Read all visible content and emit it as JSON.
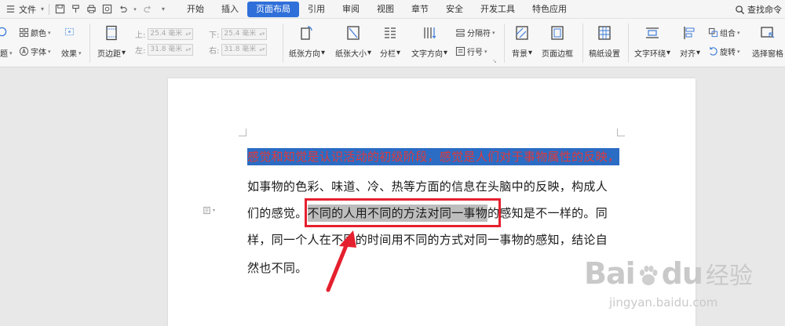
{
  "menubar": {
    "file_label": "文件",
    "tabs": [
      {
        "label": "开始",
        "active": false
      },
      {
        "label": "插入",
        "active": false
      },
      {
        "label": "页面布局",
        "active": true
      },
      {
        "label": "引用",
        "active": false
      },
      {
        "label": "审阅",
        "active": false
      },
      {
        "label": "视图",
        "active": false
      },
      {
        "label": "章节",
        "active": false
      },
      {
        "label": "安全",
        "active": false
      },
      {
        "label": "开发工具",
        "active": false
      },
      {
        "label": "特色应用",
        "active": false
      }
    ],
    "find_label": "查找命令"
  },
  "ribbon": {
    "theme_partial": "题",
    "color_label": "颜色",
    "font_label": "字体",
    "effect_label": "效果",
    "margins_label": "页边距",
    "margin_top_label": "上:",
    "margin_top_value": "25.4 毫米",
    "margin_bottom_label": "下:",
    "margin_bottom_value": "25.4 毫米",
    "margin_left_label": "左:",
    "margin_left_value": "31.8 毫米",
    "margin_right_label": "右:",
    "margin_right_value": "31.8 毫米",
    "orientation_label": "纸张方向",
    "size_label": "纸张大小",
    "columns_label": "分栏",
    "text_direction_label": "文字方向",
    "breaks_label": "分隔符",
    "line_numbers_label": "行号",
    "background_label": "背景",
    "page_border_label": "页面边框",
    "draft_paper_label": "稿纸设置",
    "text_wrap_label": "文字环绕",
    "align_label": "对齐",
    "group_label": "组合",
    "rotate_label": "旋转",
    "selection_pane_label": "选择窗格"
  },
  "document": {
    "line1_highlighted": "感觉和知觉是认识活动的初级阶段，感觉是人们对于事物属性的反映，",
    "line2": "如事物的色彩、味道、冷、热等方面的信息在头脑中的反映，构成人",
    "line3_before": "们的感觉。",
    "line3_selected": "不同的人用不同的方法对同一事物",
    "line3_after": "的感知是不一样的。同",
    "line4": "样，同一个人在不同的时间用不同的方式对同一事物的感知，结论自",
    "line5": "然也不同。"
  },
  "watermark": {
    "brand_bai": "Bai",
    "brand_du": "du",
    "brand_jy": "经验",
    "url": "jingyan.baidu.com"
  },
  "colors": {
    "active_tab": "#2f6fd9",
    "highlight_bg": "#2b6cc4",
    "highlight_text": "#e03a3a",
    "selection_gray": "#bdbdbd",
    "annotation_red": "#e5202e"
  }
}
